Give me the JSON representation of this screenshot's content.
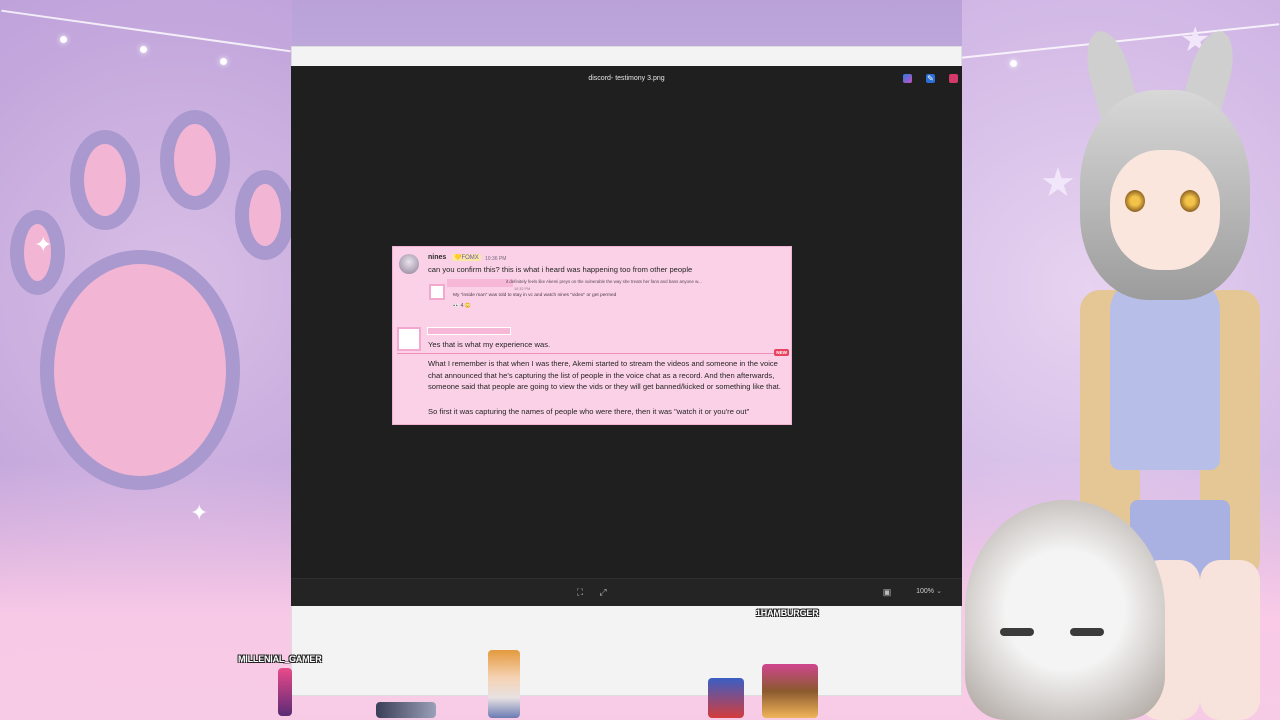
{
  "viewer": {
    "title": "discord- testimony 3.png",
    "zoom": "100%"
  },
  "discord": {
    "msg1": {
      "username": "nines",
      "tag": "💛FOMX",
      "time": "10:36 PM",
      "text": "can you confirm this? this is what i heard was happening too from other people"
    },
    "quote": {
      "line1": "it definitely feels like Akemi preys on the vulnerable the way she treats her fans and bans anyone w...",
      "time": "10:32 PM",
      "line2": "My \"inside man\" was told to stay in vc and watch nines \"video\" or get permed",
      "reactions": "👀 4   😳"
    },
    "msg2": {
      "text": "Yes that is what my experience was."
    },
    "new_badge": "NEW",
    "msg3": {
      "text": "What I remember is that when I was there, Akemi started to stream the videos and someone in the voice chat announced that he's capturing the list of people in the voice chat as a record. And then afterwards, someone said that people are going to view the vids or they will get banned/kicked or something like that."
    },
    "msg4": {
      "text": "So first it was capturing the names of people who were there, then it was \"watch it or you're out\""
    }
  },
  "overlay": {
    "name_left": "MILLENIAL_GAMER",
    "name_right": "1HAMBURGER"
  },
  "icons": {
    "fit": "fit-screen-icon",
    "fullscreen": "fullscreen-icon",
    "screenshot": "screen-icon",
    "zoom_caret": "chevron-down-icon"
  }
}
